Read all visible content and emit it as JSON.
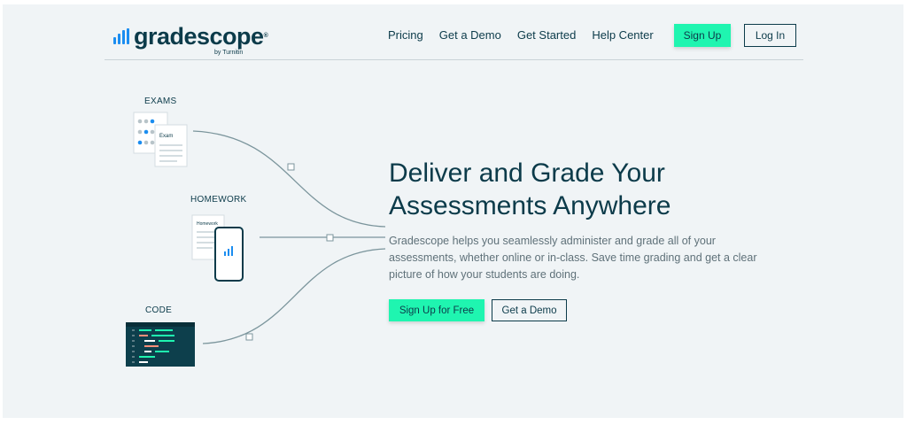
{
  "brand": {
    "name": "gradescope",
    "trademark": "®",
    "byline": "by Turnitin",
    "accent_color": "#1b8df0"
  },
  "nav": {
    "items": [
      {
        "label": "Pricing"
      },
      {
        "label": "Get a Demo"
      },
      {
        "label": "Get Started"
      },
      {
        "label": "Help Center"
      }
    ],
    "signup_label": "Sign Up",
    "login_label": "Log In"
  },
  "illustration": {
    "exams_label": "EXAMS",
    "exam_sheet_title": "Exam",
    "homework_label": "HOMEWORK",
    "homework_sheet_title": "Homework",
    "code_label": "CODE"
  },
  "hero": {
    "title": "Deliver and Grade Your Assessments Anywhere",
    "description": "Gradescope helps you seamlessly administer and grade all of your assessments, whether online or in-class. Save time grading and get a clear picture of how your students are doing.",
    "primary_cta": "Sign Up for Free",
    "secondary_cta": "Get a Demo"
  },
  "colors": {
    "cta_green": "#1ff5b0",
    "text_dark": "#0c3b4a",
    "page_bg": "#f0f4f6"
  }
}
